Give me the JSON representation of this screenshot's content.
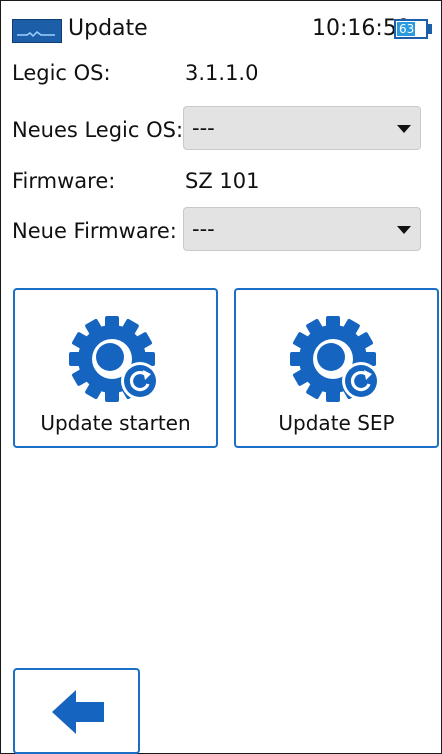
{
  "header": {
    "title": "Update",
    "time": "10:16:59",
    "battery_level": "63",
    "battery_percent": 63,
    "logo_icon": "waveform-logo-icon",
    "battery_icon": "battery-icon"
  },
  "form": {
    "legic_os_label": "Legic OS:",
    "legic_os_value": "3.1.1.0",
    "new_legic_os_label": "Neues Legic OS:",
    "new_legic_os_selected": "---",
    "firmware_label": "Firmware:",
    "firmware_value": "SZ 101",
    "new_firmware_label": "Neue Firmware:",
    "new_firmware_selected": "---"
  },
  "actions": {
    "update_start_label": "Update starten",
    "update_sep_label": "Update SEP",
    "icon": "gear-refresh-icon"
  },
  "navigation": {
    "back_icon": "arrow-left-icon"
  },
  "colors": {
    "accent": "#1c6fc7",
    "icon_blue": "#1565c0",
    "select_bg": "#e3e3e3"
  }
}
